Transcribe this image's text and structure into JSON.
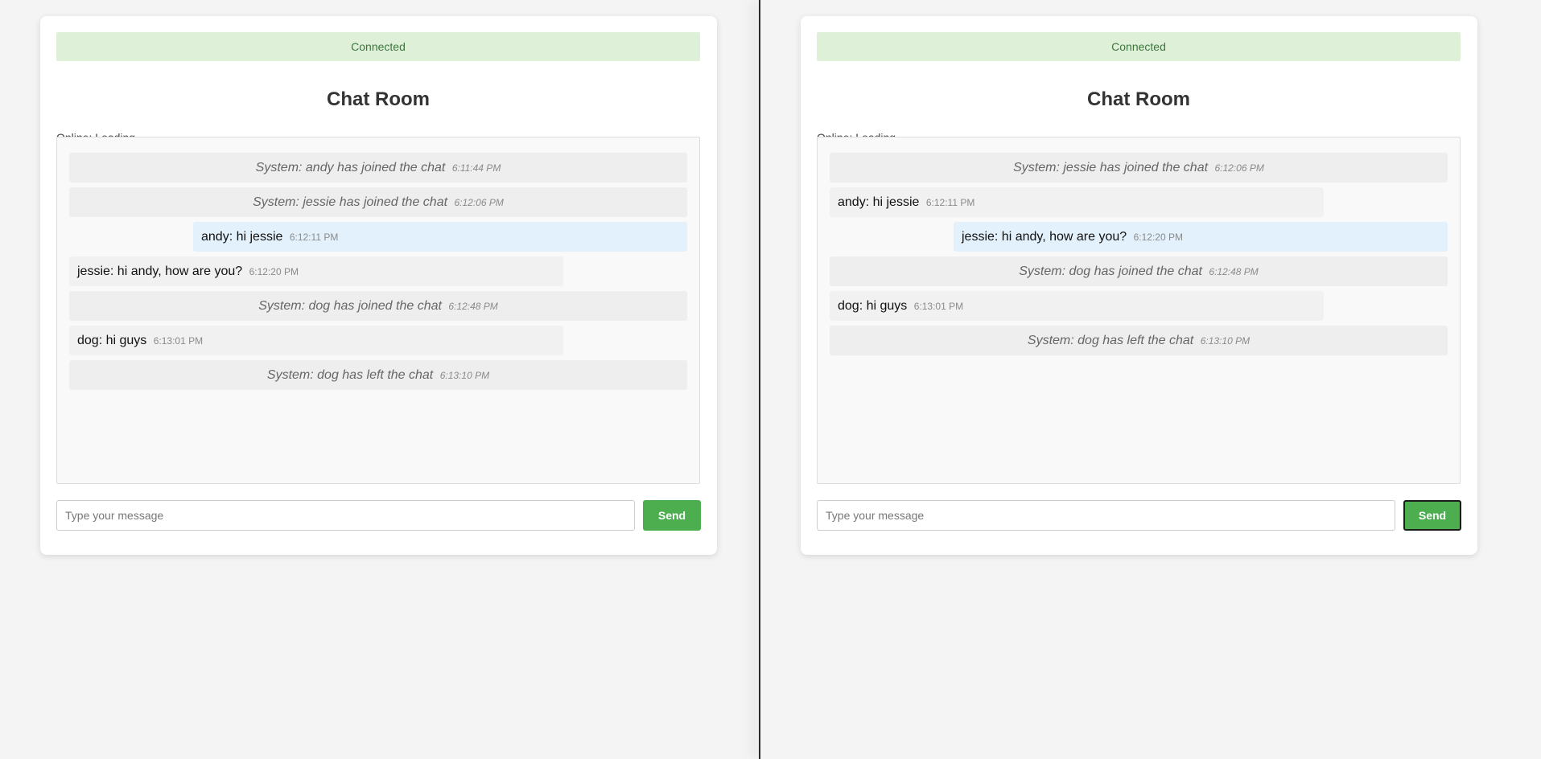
{
  "windows": [
    {
      "status": "Connected",
      "title": "Chat Room",
      "online": "Online: Loading...",
      "input_placeholder": "Type your message",
      "send_label": "Send",
      "send_focused": false,
      "messages": [
        {
          "kind": "system",
          "text": "System: andy has joined the chat",
          "time": "6:11:44 PM"
        },
        {
          "kind": "system",
          "text": "System: jessie has joined the chat",
          "time": "6:12:06 PM"
        },
        {
          "kind": "self",
          "text": "andy: hi jessie",
          "time": "6:12:11 PM"
        },
        {
          "kind": "other",
          "text": "jessie: hi andy, how are you?",
          "time": "6:12:20 PM"
        },
        {
          "kind": "system",
          "text": "System: dog has joined the chat",
          "time": "6:12:48 PM"
        },
        {
          "kind": "other",
          "text": "dog: hi guys",
          "time": "6:13:01 PM"
        },
        {
          "kind": "system",
          "text": "System: dog has left the chat",
          "time": "6:13:10 PM"
        }
      ]
    },
    {
      "status": "Connected",
      "title": "Chat Room",
      "online": "Online: Loading...",
      "input_placeholder": "Type your message",
      "send_label": "Send",
      "send_focused": true,
      "messages": [
        {
          "kind": "system",
          "text": "System: jessie has joined the chat",
          "time": "6:12:06 PM"
        },
        {
          "kind": "other",
          "text": "andy: hi jessie",
          "time": "6:12:11 PM"
        },
        {
          "kind": "self",
          "text": "jessie: hi andy, how are you?",
          "time": "6:12:20 PM"
        },
        {
          "kind": "system",
          "text": "System: dog has joined the chat",
          "time": "6:12:48 PM"
        },
        {
          "kind": "other",
          "text": "dog: hi guys",
          "time": "6:13:01 PM"
        },
        {
          "kind": "system",
          "text": "System: dog has left the chat",
          "time": "6:13:10 PM"
        }
      ]
    }
  ],
  "colors": {
    "page_background": "#f4f4f4",
    "status_background": "#dff0d8",
    "status_text": "#3c763d",
    "send_button": "#4cae4f",
    "self_message": "#e3f1fc",
    "system_message": "#eeeeee"
  }
}
